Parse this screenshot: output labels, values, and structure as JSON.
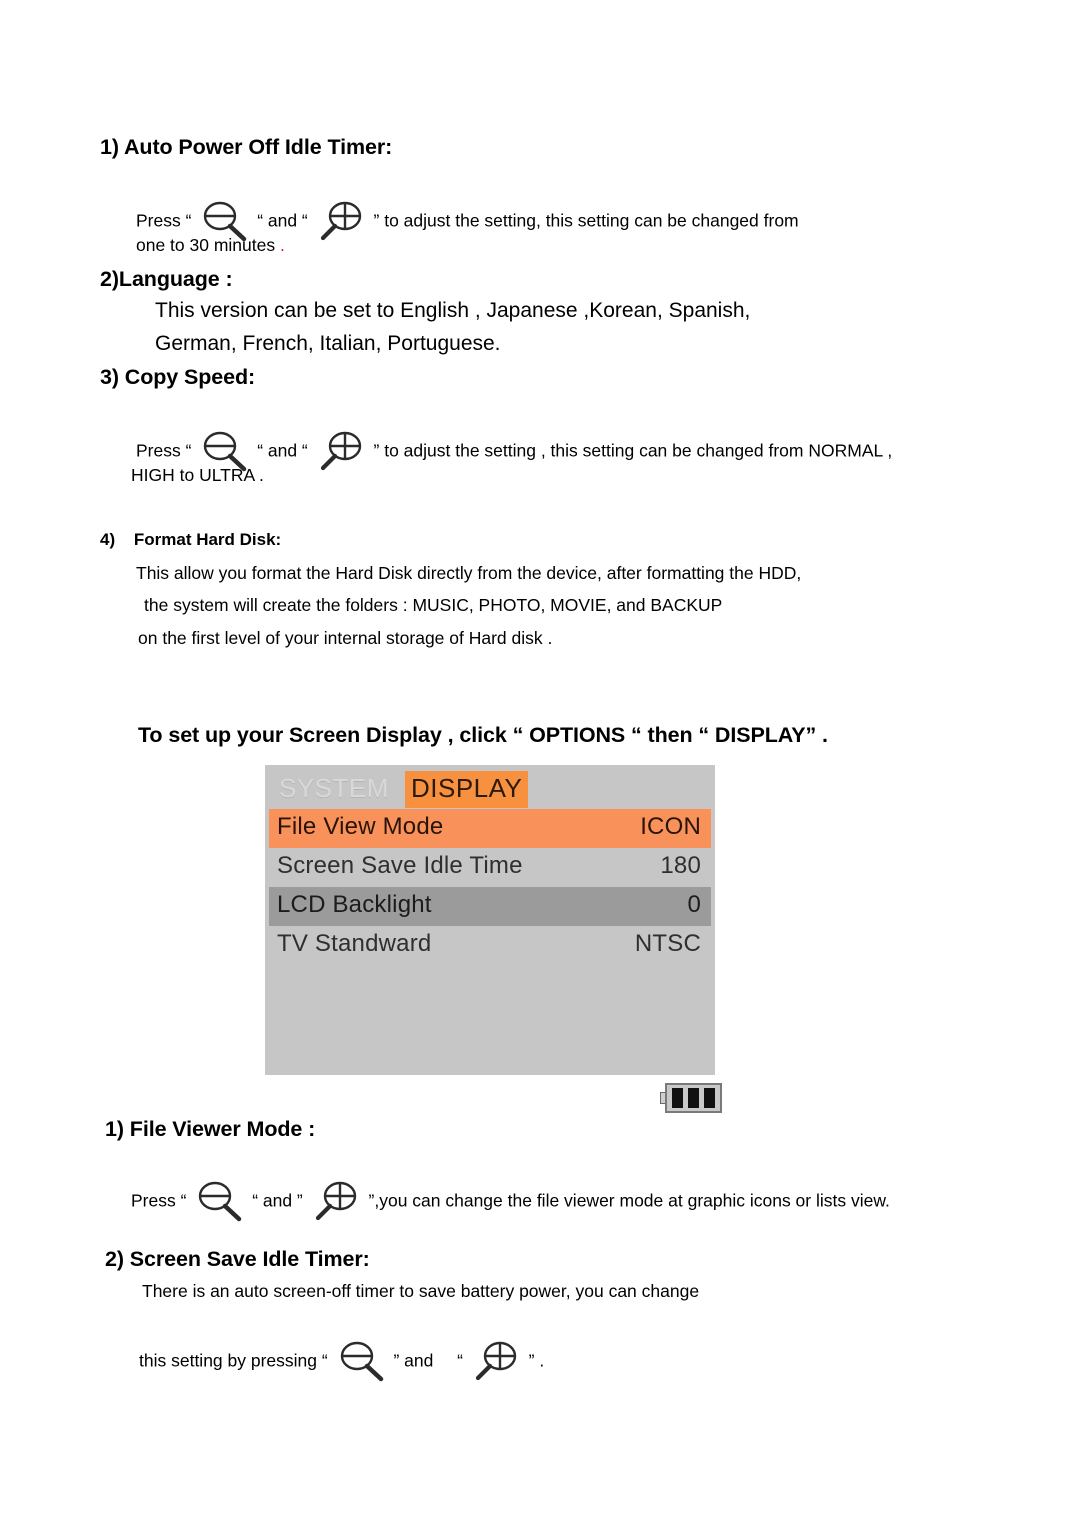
{
  "document": {
    "sections": [
      {
        "id": "auto-power-off",
        "heading": "1) Auto Power Off Idle Timer:",
        "line1_pre": "Press “",
        "line1_mid": "“ and “",
        "line1_post": "” to adjust the setting, this setting can be changed from",
        "line2": "one to 30 minutes",
        "line2_period": "."
      },
      {
        "id": "language",
        "heading": "2)Language :",
        "line1": "This version can be set to English , Japanese ,Korean, Spanish,",
        "line2": "German, French, Italian, Portuguese."
      },
      {
        "id": "copy-speed",
        "heading": "3)  Copy Speed:",
        "line1_pre": "Press “",
        "line1_mid": "“ and “",
        "line1_post": "” to adjust the setting , this setting can be changed from NORMAL ,",
        "line2": "HIGH to ULTRA ."
      },
      {
        "id": "format-hard-disk",
        "heading_num": "4)",
        "heading": "Format Hard Disk:",
        "line1": "This allow you format the Hard Disk directly from the device, after formatting the HDD,",
        "line2": "the system will create the folders : MUSIC, PHOTO, MOVIE, and BACKUP",
        "line3": "on the first level of your internal storage of Hard disk ."
      }
    ],
    "display_intro": "To set up your Screen Display , click “    OPTIONS    “ then “ DISPLAY” .",
    "bottom_sections": [
      {
        "id": "file-viewer-mode",
        "heading": "1) File Viewer Mode :",
        "line1_pre": "Press “",
        "line1_mid": "“ and ”",
        "line1_post": "”,you can change the file viewer mode at graphic icons or lists view."
      },
      {
        "id": "screen-save-idle-timer",
        "heading": "2) Screen Save Idle Timer:",
        "line1": "There is an auto screen-off timer to save battery power, you can change",
        "line2_pre": "this setting by pressing “",
        "line2_mid": "” and",
        "line2_mid2": "“",
        "line2_post": "” ."
      }
    ]
  },
  "device_screen": {
    "tabs": [
      {
        "label": "SYSTEM",
        "active": false
      },
      {
        "label": "DISPLAY",
        "active": true
      }
    ],
    "menu_rows": [
      {
        "label": "File View Mode",
        "value": "ICON",
        "highlight": "orange"
      },
      {
        "label": "Screen Save Idle Time",
        "value": "180",
        "highlight": "none"
      },
      {
        "label": "LCD Backlight",
        "value": "0",
        "highlight": "gray"
      },
      {
        "label": "TV Standward",
        "value": "NTSC",
        "highlight": "none"
      }
    ],
    "battery": {
      "bars": 3
    },
    "colors": {
      "panel_bg": "#c6c6c6",
      "accent_orange": "#f7913f",
      "row_orange": "#f9915a",
      "row_gray": "#9b9b9b",
      "inactive_tab": "#d8d8d8"
    }
  },
  "icons": {
    "zoom_out": "magnifier-minus-icon",
    "zoom_in": "magnifier-plus-icon",
    "battery": "battery-icon"
  }
}
